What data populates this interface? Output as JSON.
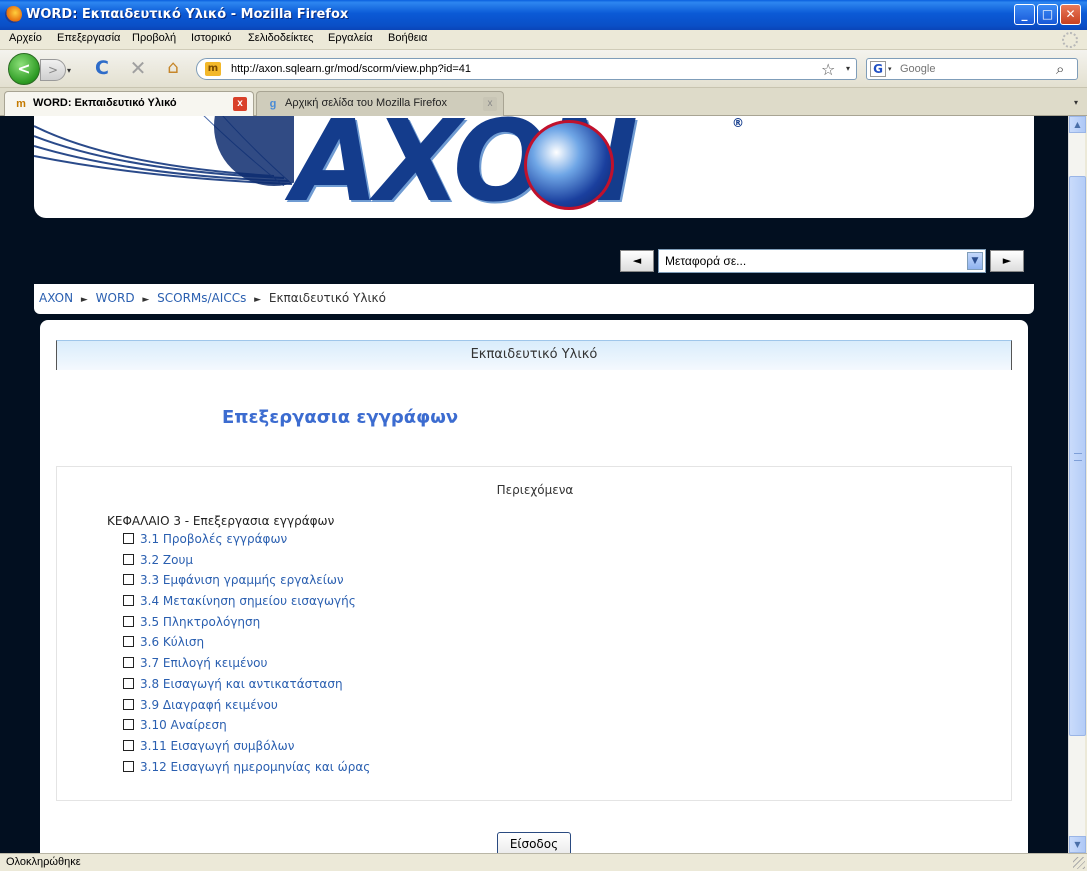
{
  "window": {
    "title": "WORD: Εκπαιδευτικό Υλικό - Mozilla Firefox",
    "minimize": "_",
    "maximize": "□",
    "close": "✕"
  },
  "menu": {
    "items": [
      "Αρχείο",
      "Επεξεργασία",
      "Προβολή",
      "Ιστορικό",
      "Σελιδοδείκτες",
      "Εργαλεία",
      "Βοήθεια"
    ]
  },
  "nav": {
    "back_icon": "arrow-left-icon",
    "forward_icon": "arrow-right-icon",
    "back_glyph": "<",
    "forward_glyph": ">",
    "dropdown_glyph": "▾",
    "reload_glyph": "C",
    "stop_glyph": "✕",
    "home_glyph": "⌂",
    "url": "http://axon.sqlearn.gr/mod/scorm/view.php?id=41",
    "site_icon_glyph": "m",
    "star_glyph": "☆",
    "search_engine_glyph": "G",
    "search_placeholder": "Google",
    "search_go_glyph": "⌕"
  },
  "tabs": [
    {
      "label": "WORD: Εκπαιδευτικό Υλικό",
      "icon_glyph": "m",
      "close_glyph": "x"
    },
    {
      "label": "Αρχική σελίδα του Mozilla Firefox",
      "icon_glyph": "g",
      "close_glyph": "x"
    }
  ],
  "tab_list_glyph": "▾",
  "page": {
    "logo_text": "AXON",
    "logo_reg": "®",
    "jump_prev": "◄",
    "jump_next": "►",
    "jump_select_value": "Μεταφορά σε...",
    "jump_select_arrow": "▼",
    "breadcrumb": {
      "sep": "►",
      "items": [
        "AXON",
        "WORD",
        "SCORMs/AICCs"
      ],
      "current": "Εκπαιδευτικό Υλικό"
    },
    "content_header": "Εκπαιδευτικό Υλικό",
    "heading": "Επεξεργασια εγγράφων",
    "toc": {
      "title": "Περιεχόμενα",
      "chapter": "ΚΕΦΑΛΑΙΟ 3 - Επεξεργασια εγγράφων",
      "items": [
        "3.1 Προβολές εγγράφων",
        "3.2 Ζουμ",
        "3.3 Εμφάνιση γραμμής εργαλείων",
        "3.4 Μετακίνηση σημείου εισαγωγής",
        "3.5 Πληκτρολόγηση",
        "3.6 Κύλιση",
        "3.7 Επιλογή κειμένου",
        "3.8 Εισαγωγή και αντικατάσταση",
        "3.9 Διαγραφή κειμένου",
        "3.10 Αναίρεση",
        "3.11 Εισαγωγή συμβόλων",
        "3.12 Εισαγωγή ημερομηνίας και ώρας"
      ]
    },
    "enter_button": "Είσοδος"
  },
  "scrollbar": {
    "up_glyph": "▲",
    "down_glyph": "▼"
  },
  "status": {
    "text": "Ολοκληρώθηκε"
  },
  "colors": {
    "titlebar": "#0a5fde",
    "link": "#2a5fb0",
    "heading": "#3c6cd0",
    "page_bg": "#020f20"
  }
}
